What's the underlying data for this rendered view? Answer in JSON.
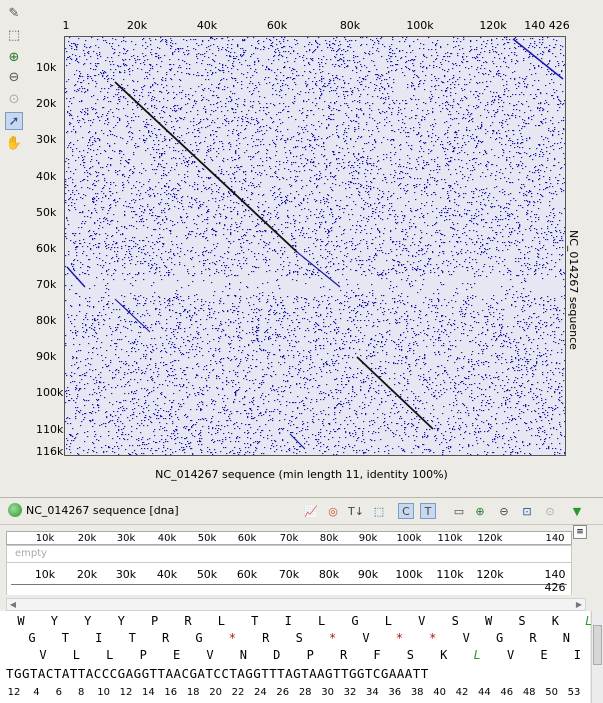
{
  "toolbar_left": {
    "icons": [
      "pencil-icon",
      "select-rect-icon",
      "zoom-in-icon",
      "zoom-out-icon",
      "zoom-fit-icon",
      "pointer-icon",
      "hand-icon"
    ]
  },
  "dotplot": {
    "x_ticks": [
      "1",
      "20k",
      "40k",
      "60k",
      "80k",
      "100k",
      "120k",
      "140 426"
    ],
    "y_ticks": [
      "10k",
      "20k",
      "30k",
      "40k",
      "50k",
      "60k",
      "70k",
      "80k",
      "90k",
      "100k",
      "110k",
      "116k"
    ],
    "y_axis_label": "NC_014267 sequence",
    "x_axis_label": "NC_014267 sequence (min length 11, identity 100%)",
    "colors": {
      "background": "#e7e7f3",
      "dots": "#1a1aa8",
      "diagonal": "#111111"
    }
  },
  "sequence_panel": {
    "title": "NC_014267 sequence [dna]",
    "ruler1_ticks": [
      "10k",
      "20k",
      "30k",
      "40k",
      "50k",
      "60k",
      "70k",
      "80k",
      "90k",
      "100k",
      "110k",
      "120k",
      "140 426"
    ],
    "empty_label": "empty",
    "ruler2_ticks": [
      "10k",
      "20k",
      "30k",
      "40k",
      "50k",
      "60k",
      "70k",
      "80k",
      "90k",
      "100k",
      "110k",
      "120k",
      "140 426"
    ],
    "frame1": [
      "W",
      "Y",
      "Y",
      "Y",
      "P",
      "R",
      "L",
      "T",
      "I",
      "L",
      "G",
      "L",
      "V",
      "S",
      "W",
      "S",
      "K",
      "L"
    ],
    "frame2": [
      "G",
      "T",
      "I",
      "T",
      "R",
      "G",
      "*",
      "R",
      "S",
      "*",
      "V",
      "*",
      "*",
      "V",
      "G",
      "R",
      "N"
    ],
    "frame3": [
      "V",
      "L",
      "L",
      "P",
      "E",
      "V",
      "N",
      "D",
      "P",
      "R",
      "F",
      "S",
      "K",
      "L",
      "V",
      "E",
      "I"
    ],
    "dna": "TGGTACTATTACCCGAGGTTAACGATCCTAGGTTTAGTAAGTTGGTCGAAATT",
    "numbers": [
      "12",
      "4",
      "6",
      "8",
      "10",
      "12",
      "14",
      "16",
      "18",
      "20",
      "22",
      "24",
      "26",
      "28",
      "30",
      "32",
      "34",
      "36",
      "38",
      "40",
      "42",
      "44",
      "46",
      "48",
      "50",
      "53"
    ]
  }
}
